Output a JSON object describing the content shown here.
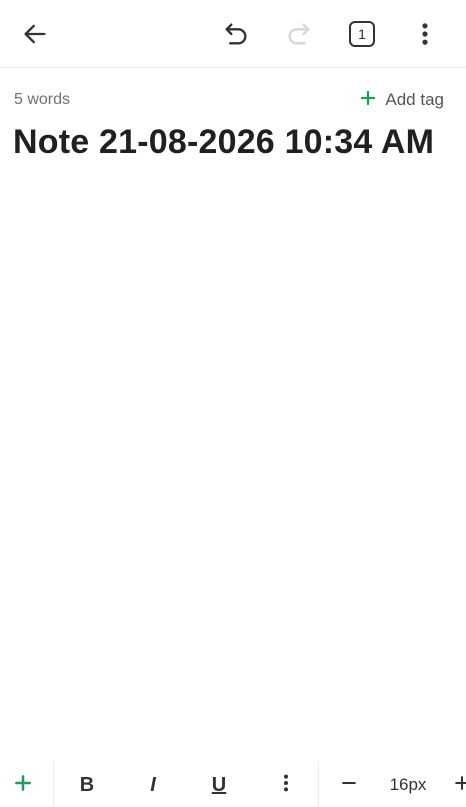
{
  "header": {
    "back": "arrow-left",
    "undo": "undo",
    "redo": "redo",
    "tab_count": "1",
    "more": "more-vertical"
  },
  "meta": {
    "word_count": "5 words",
    "add_tag_label": "Add tag"
  },
  "note": {
    "title": "Note 21-08-2026 10:34 AM"
  },
  "toolbar": {
    "bold": "B",
    "italic": "I",
    "underline": "U",
    "font_size": "16px"
  },
  "colors": {
    "accent": "#1f9d55",
    "redo_disabled": "#d6d6d6",
    "icon": "#333333"
  }
}
